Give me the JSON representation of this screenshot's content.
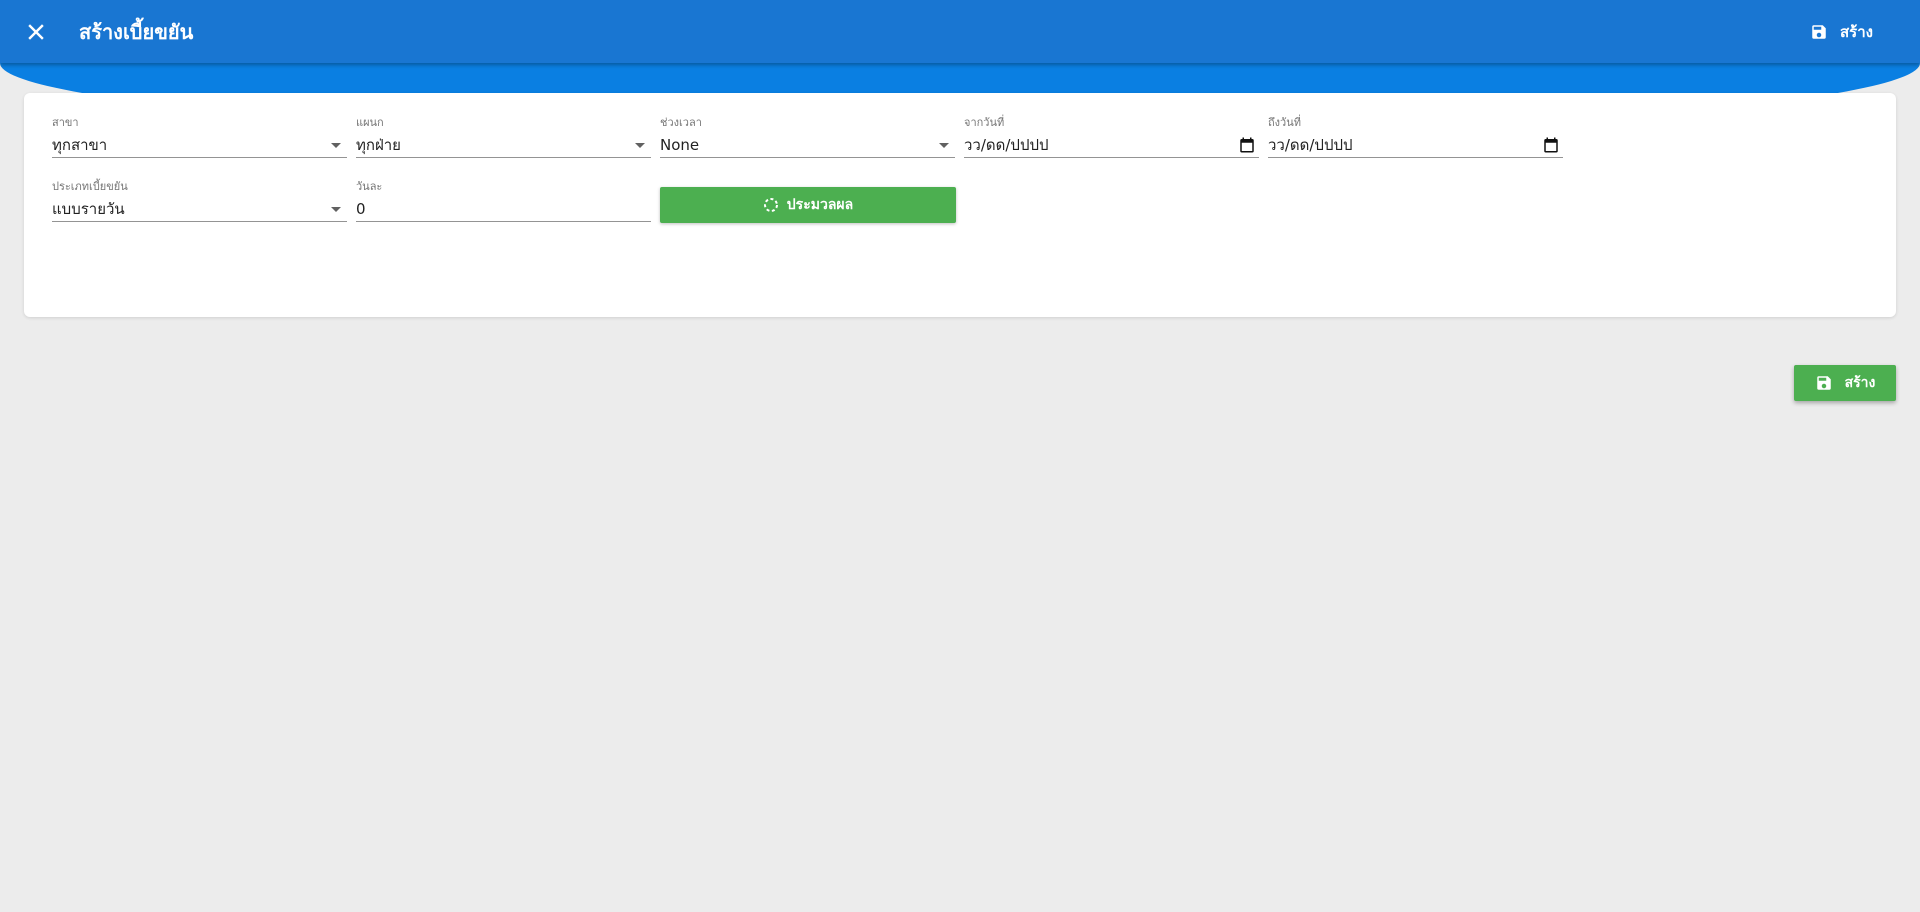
{
  "header": {
    "title": "สร้างเบี้ยขยัน",
    "save_label": "สร้าง",
    "close_icon": "close-icon",
    "save_icon": "floppy-disk-icon",
    "background_color": "#1976d2"
  },
  "form": {
    "branch": {
      "label": "สาขา",
      "value": "ทุกสาขา"
    },
    "department": {
      "label": "แผนก",
      "value": "ทุกฝ่าย"
    },
    "period": {
      "label": "ช่วงเวลา",
      "value": "None"
    },
    "from_date": {
      "label": "จากวันที่",
      "placeholder": "วว/ดด/ปปปป"
    },
    "to_date": {
      "label": "ถึงวันที่",
      "placeholder": "วว/ดด/ปปปป"
    },
    "allowance_type": {
      "label": "ประเภทเบี้ยขยัน",
      "value": "แบบรายวัน"
    },
    "per_day": {
      "label": "วันละ",
      "value": "0"
    },
    "process_label": "ประมวลผล",
    "process_icon": "loading-spinner-icon",
    "process_color": "#4caf50"
  },
  "footer": {
    "save_label": "สร้าง",
    "save_icon": "floppy-disk-icon",
    "save_color": "#4caf50"
  }
}
